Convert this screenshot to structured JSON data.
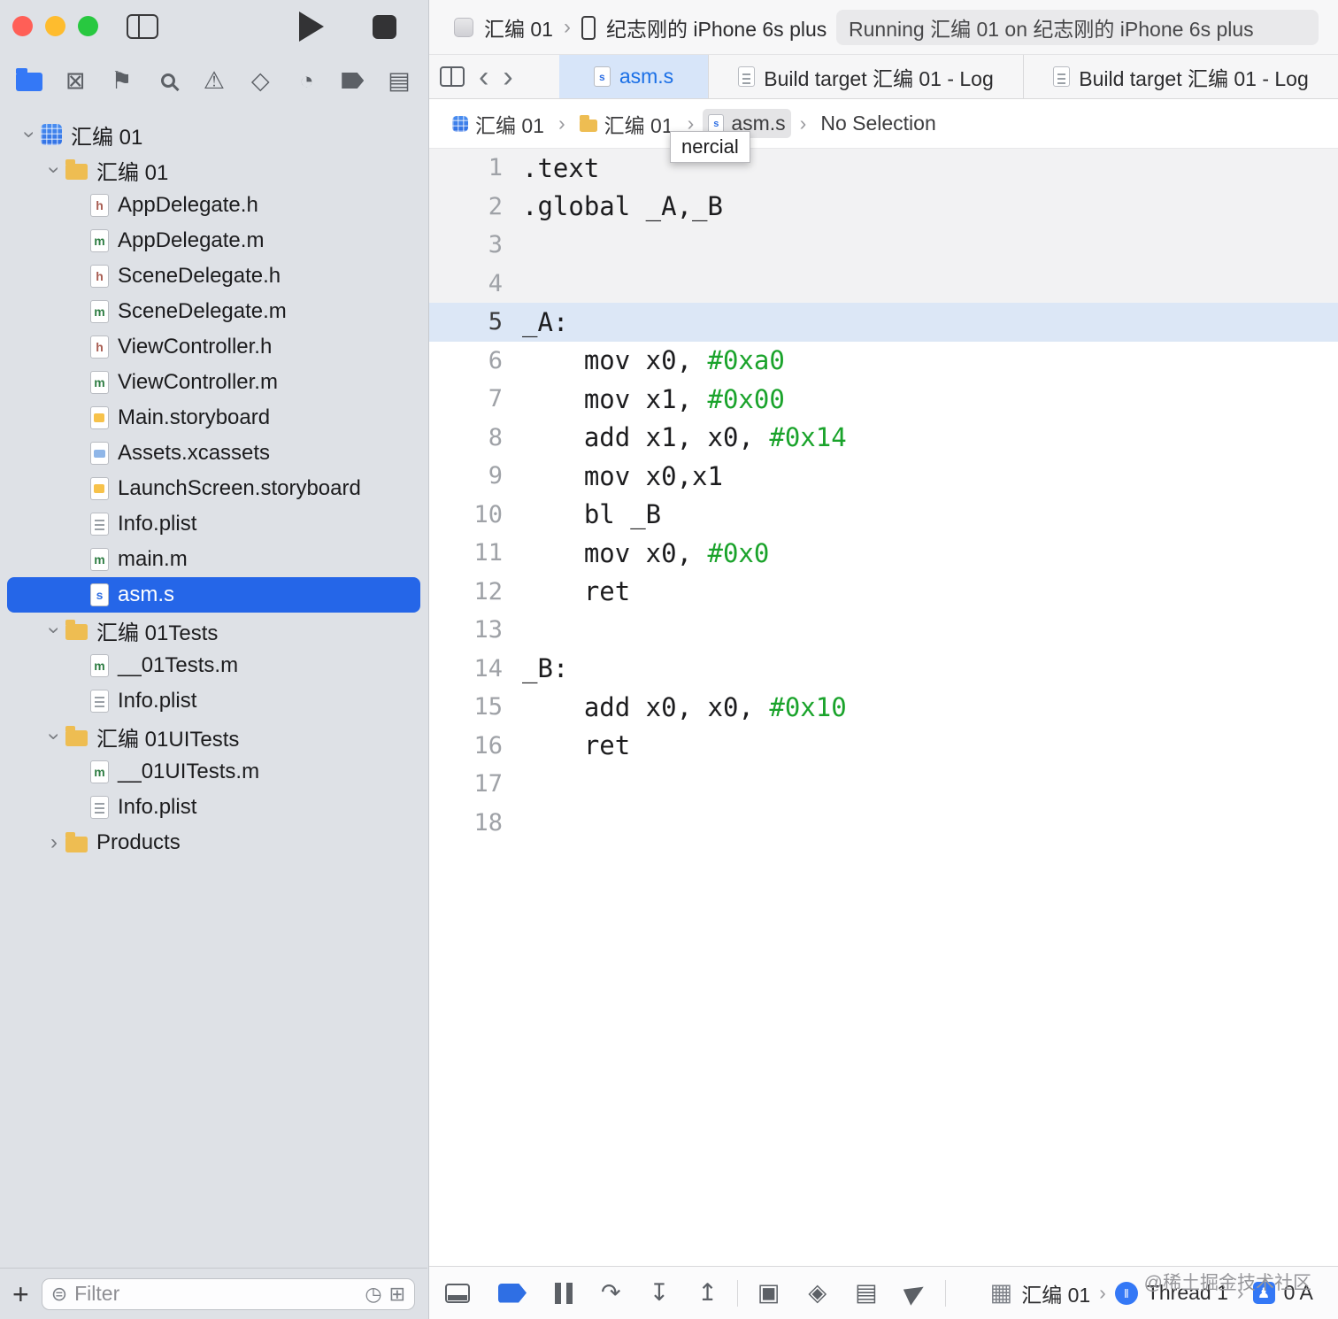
{
  "titlebar": {
    "scheme": "汇编 01",
    "device": "纪志刚的 iPhone 6s plus",
    "status": "Running 汇编 01 on 纪志刚的 iPhone 6s plus"
  },
  "navigator": {
    "filter_placeholder": "Filter",
    "tree": [
      {
        "label": "汇编 01",
        "icon": "project",
        "level": 0,
        "chevron": "down"
      },
      {
        "label": "汇编 01",
        "icon": "folder",
        "level": 1,
        "chevron": "down"
      },
      {
        "label": "AppDelegate.h",
        "icon": "h",
        "level": 2
      },
      {
        "label": "AppDelegate.m",
        "icon": "m",
        "level": 2
      },
      {
        "label": "SceneDelegate.h",
        "icon": "h",
        "level": 2
      },
      {
        "label": "SceneDelegate.m",
        "icon": "m",
        "level": 2
      },
      {
        "label": "ViewController.h",
        "icon": "h",
        "level": 2
      },
      {
        "label": "ViewController.m",
        "icon": "m",
        "level": 2
      },
      {
        "label": "Main.storyboard",
        "icon": "storyboard",
        "level": 2
      },
      {
        "label": "Assets.xcassets",
        "icon": "xcassets",
        "level": 2
      },
      {
        "label": "LaunchScreen.storyboard",
        "icon": "storyboard",
        "level": 2
      },
      {
        "label": "Info.plist",
        "icon": "plist",
        "level": 2
      },
      {
        "label": "main.m",
        "icon": "m",
        "level": 2
      },
      {
        "label": "asm.s",
        "icon": "s",
        "level": 2,
        "selected": true
      },
      {
        "label": "汇编 01Tests",
        "icon": "folder",
        "level": 1,
        "chevron": "down"
      },
      {
        "label": "__01Tests.m",
        "icon": "m",
        "level": 2
      },
      {
        "label": "Info.plist",
        "icon": "plist",
        "level": 2
      },
      {
        "label": "汇编 01UITests",
        "icon": "folder",
        "level": 1,
        "chevron": "down"
      },
      {
        "label": "__01UITests.m",
        "icon": "m",
        "level": 2
      },
      {
        "label": "Info.plist",
        "icon": "plist",
        "level": 2
      },
      {
        "label": "Products",
        "icon": "folder",
        "level": 1,
        "chevron": "right"
      }
    ]
  },
  "tabs": {
    "items": [
      {
        "label": "asm.s",
        "icon": "s",
        "active": true
      },
      {
        "label": "Build target 汇编 01 - Log",
        "icon": "plist",
        "active": false
      },
      {
        "label": "Build target 汇编 01 - Log",
        "icon": "plist",
        "active": false
      }
    ]
  },
  "jumpbar": {
    "items": [
      {
        "label": "汇编 01",
        "icon": "project"
      },
      {
        "label": "汇编 01",
        "icon": "folder"
      },
      {
        "label": "asm.s",
        "icon": "s",
        "hovered": true
      },
      {
        "label": "No Selection"
      }
    ],
    "tooltip": "nercial"
  },
  "editor": {
    "lines": [
      {
        "num": "1",
        "state": "dim",
        "segs": [
          {
            "t": ".text"
          }
        ]
      },
      {
        "num": "2",
        "state": "dim",
        "segs": [
          {
            "t": ".global _A,_B"
          }
        ]
      },
      {
        "num": "3",
        "state": "dim",
        "segs": []
      },
      {
        "num": "4",
        "state": "dim",
        "segs": []
      },
      {
        "num": "5",
        "state": "current",
        "segs": [
          {
            "t": "_A:"
          }
        ]
      },
      {
        "num": "6",
        "segs": [
          {
            "t": "    mov x0, "
          },
          {
            "t": "#0xa0",
            "c": "g"
          }
        ]
      },
      {
        "num": "7",
        "segs": [
          {
            "t": "    mov x1, "
          },
          {
            "t": "#0x00",
            "c": "g"
          }
        ]
      },
      {
        "num": "8",
        "segs": [
          {
            "t": "    add x1, x0, "
          },
          {
            "t": "#0x14",
            "c": "g"
          }
        ]
      },
      {
        "num": "9",
        "segs": [
          {
            "t": "    mov x0,x1"
          }
        ]
      },
      {
        "num": "10",
        "segs": [
          {
            "t": "    bl _B"
          }
        ]
      },
      {
        "num": "11",
        "segs": [
          {
            "t": "    mov x0, "
          },
          {
            "t": "#0x0",
            "c": "g"
          }
        ]
      },
      {
        "num": "12",
        "segs": [
          {
            "t": "    ret"
          }
        ]
      },
      {
        "num": "13",
        "segs": []
      },
      {
        "num": "14",
        "segs": [
          {
            "t": "_B:"
          }
        ]
      },
      {
        "num": "15",
        "segs": [
          {
            "t": "    add x0, x0, "
          },
          {
            "t": "#0x10",
            "c": "g"
          }
        ]
      },
      {
        "num": "16",
        "segs": [
          {
            "t": "    ret"
          }
        ]
      },
      {
        "num": "17",
        "segs": []
      },
      {
        "num": "18",
        "segs": []
      }
    ]
  },
  "debugbar": {
    "process": "汇编 01",
    "thread": "Thread 1",
    "frame": "0 A"
  },
  "watermark": "@稀土掘金技术社区",
  "icons": {
    "chevron": "›",
    "back": "‹",
    "forward": "›",
    "plus": "+",
    "filter": "⊜",
    "clock": "◷",
    "add_box": "⊞",
    "source_control": "⊠",
    "symbol": "⚑",
    "issue": "⚠",
    "test": "◇",
    "debug_gauge": "◔",
    "report": "▤",
    "step_over": "↷",
    "step_into": "↧",
    "step_out": "↥",
    "view_hierarchy": "▣",
    "memory_graph": "◈",
    "env_overrides": "▤",
    "process_grid": "▦",
    "thread_bars": "‖",
    "frame_glyph": "♟"
  }
}
